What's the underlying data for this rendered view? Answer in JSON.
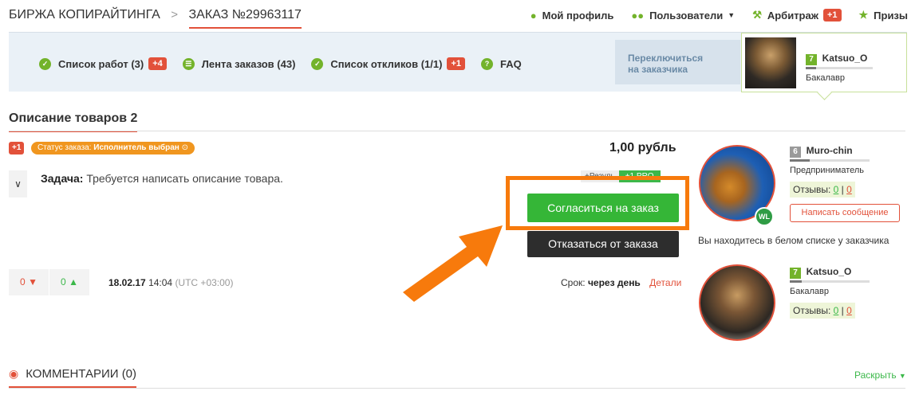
{
  "header": {
    "breadcrumb_root": "БИРЖА КОПИРАЙТИНГА",
    "breadcrumb_sep": ">",
    "order_number": "ЗАКАЗ №29963117",
    "nav": {
      "profile": "Мой профиль",
      "users": "Пользователи",
      "arbitration": "Арбитраж",
      "arbitration_badge": "+1",
      "prizes": "Призы"
    }
  },
  "subnav": {
    "works": "Список работ (3)",
    "works_badge": "+4",
    "orders_feed": "Лента заказов (43)",
    "responses": "Список откликов (1/1)",
    "responses_badge": "+1",
    "faq": "FAQ",
    "switch_line1": "Переключиться",
    "switch_line2": "на заказчика",
    "current_user": {
      "level": "7",
      "name": "Katsuo_O",
      "rank": "Бакалавр",
      "rank_progress": 0.15
    }
  },
  "section": {
    "title": "Описание товаров 2"
  },
  "order": {
    "plus_badge": "+1",
    "status_label": "Статус заказа:",
    "status_value": "Исполнитель выбран",
    "price": "1,00 рубль",
    "task_label": "Задача:",
    "task_text": "Требуется написать описание товара.",
    "tag_left": "+Резуль",
    "tag_right": "+1 PRO",
    "agree_button": "Согласиться на заказ",
    "decline_button": "Отказаться от заказа",
    "votes_down": "0",
    "votes_up": "0",
    "date": "18.02.17",
    "time": "14:04",
    "timezone": "(UTC +03:00)",
    "deadline_label": "Срок:",
    "deadline_value": "через день",
    "details_link": "Детали"
  },
  "customer": {
    "level": "6",
    "name": "Muro-chin",
    "rank": "Предприниматель",
    "rank_progress": 0.25,
    "reviews_label": "Отзывы:",
    "reviews_good": "0",
    "reviews_sep": "|",
    "reviews_bad": "0",
    "message_button": "Написать сообщение",
    "wl_badge": "WL",
    "whitelist_text": "Вы находитесь в белом списке у заказчика"
  },
  "executor": {
    "level": "7",
    "name": "Katsuo_O",
    "rank": "Бакалавр",
    "rank_progress": 0.15,
    "reviews_label": "Отзывы:",
    "reviews_good": "0",
    "reviews_sep": "|",
    "reviews_bad": "0"
  },
  "comments": {
    "title": "КОММЕНТАРИИ (0)",
    "expand": "Раскрыть"
  },
  "colors": {
    "accent_red": "#e2513a",
    "green": "#35b637",
    "highlight_orange": "#f77a0c",
    "status_orange": "#f0961f"
  }
}
